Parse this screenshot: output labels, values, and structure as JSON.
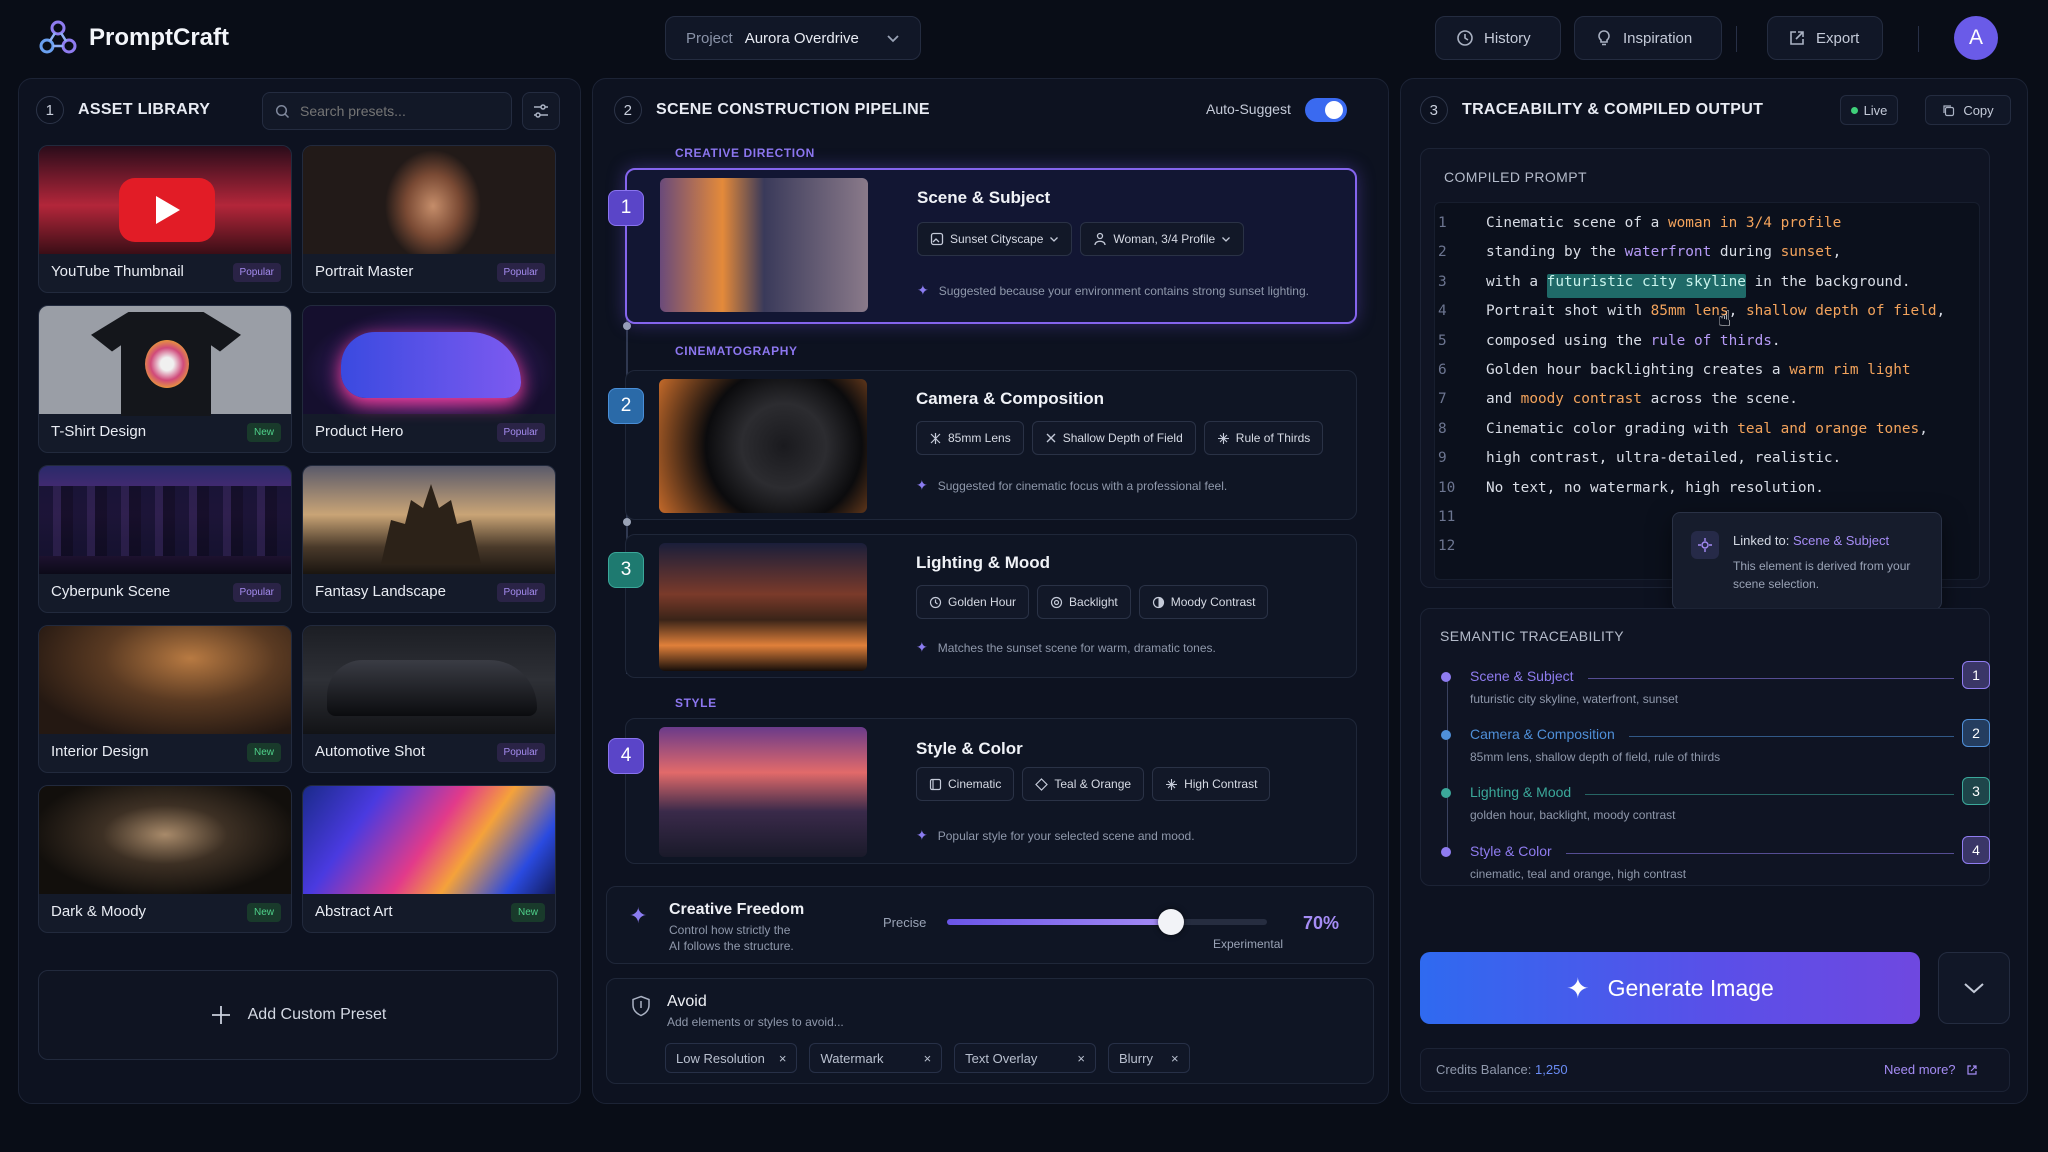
{
  "app": {
    "name": "PromptCraft"
  },
  "header": {
    "project_label": "Project",
    "project_name": "Aurora Overdrive",
    "history": "History",
    "inspiration": "Inspiration",
    "export": "Export",
    "avatar_initial": "A"
  },
  "library": {
    "num": "1",
    "title": "ASSET LIBRARY",
    "search_placeholder": "Search presets...",
    "add_custom": "Add Custom Preset",
    "presets": [
      {
        "label": "YouTube Thumbnail",
        "badge": "Popular"
      },
      {
        "label": "Portrait Master",
        "badge": "Popular"
      },
      {
        "label": "T-Shirt Design",
        "badge": "New"
      },
      {
        "label": "Product Hero",
        "badge": "Popular"
      },
      {
        "label": "Cyberpunk Scene",
        "badge": "Popular"
      },
      {
        "label": "Fantasy Landscape",
        "badge": "Popular"
      },
      {
        "label": "Interior Design",
        "badge": "New"
      },
      {
        "label": "Automotive Shot",
        "badge": "Popular"
      },
      {
        "label": "Dark & Moody",
        "badge": "New"
      },
      {
        "label": "Abstract Art",
        "badge": "New"
      }
    ]
  },
  "pipeline": {
    "num": "2",
    "title": "SCENE CONSTRUCTION PIPELINE",
    "auto_suggest": "Auto-Suggest",
    "auto_suggest_on": true,
    "sections": {
      "creative": "CREATIVE DIRECTION",
      "cinema": "CINEMATOGRAPHY",
      "style": "STYLE"
    },
    "steps": [
      {
        "num": "1",
        "title": "Scene & Subject",
        "chips": [
          "Sunset Cityscape",
          "Woman, 3/4 Profile"
        ],
        "hint": "Suggested because your environment contains strong sunset lighting."
      },
      {
        "num": "2",
        "title": "Camera & Composition",
        "chips": [
          "85mm Lens",
          "Shallow Depth of Field",
          "Rule of Thirds"
        ],
        "hint": "Suggested for cinematic focus with a professional feel."
      },
      {
        "num": "3",
        "title": "Lighting & Mood",
        "chips": [
          "Golden Hour",
          "Backlight",
          "Moody Contrast"
        ],
        "hint": "Matches the sunset scene for warm, dramatic tones."
      },
      {
        "num": "4",
        "title": "Style & Color",
        "chips": [
          "Cinematic",
          "Teal & Orange",
          "High Contrast"
        ],
        "hint": "Popular style for your selected scene and mood."
      }
    ],
    "freedom": {
      "title": "Creative Freedom",
      "desc1": "Control how strictly the",
      "desc2": "AI follows the structure.",
      "left": "Precise",
      "right": "Experimental",
      "value_label": "70%",
      "value": 0.7
    },
    "avoid": {
      "title": "Avoid",
      "desc": "Add elements or styles to avoid...",
      "tags": [
        "Low Resolution",
        "Watermark",
        "Text Overlay",
        "Blurry"
      ]
    }
  },
  "output": {
    "num": "3",
    "title": "TRACEABILITY & COMPILED OUTPUT",
    "live": "Live",
    "copy": "Copy",
    "compiled_title": "COMPILED PROMPT",
    "lines": [
      {
        "n": "1",
        "parts": [
          [
            "t",
            "Cinematic scene of a "
          ],
          [
            "o",
            "woman in 3/4 profile"
          ]
        ]
      },
      {
        "n": "2",
        "parts": [
          [
            "t",
            "standing by the "
          ],
          [
            "p",
            "waterfront"
          ],
          [
            "t",
            " during "
          ],
          [
            "o",
            "sunset"
          ],
          [
            "t",
            ","
          ]
        ]
      },
      {
        "n": "3",
        "parts": [
          [
            "t",
            "with a "
          ],
          [
            "hl",
            "futuristic city skyline"
          ],
          [
            "t",
            " in the background."
          ]
        ]
      },
      {
        "n": "4",
        "parts": [
          [
            "t",
            "Portrait shot with "
          ],
          [
            "o",
            "85mm lens"
          ],
          [
            "t",
            ", "
          ],
          [
            "o",
            "shallow depth of field"
          ],
          [
            "t",
            ","
          ]
        ]
      },
      {
        "n": "5",
        "parts": [
          [
            "t",
            "composed using the "
          ],
          [
            "p",
            "rule of thirds"
          ],
          [
            "t",
            "."
          ]
        ]
      },
      {
        "n": "6",
        "parts": [
          [
            "t",
            "Golden hour backlighting creates a "
          ],
          [
            "o",
            "warm rim light"
          ]
        ]
      },
      {
        "n": "7",
        "parts": [
          [
            "t",
            "and "
          ],
          [
            "o",
            "moody contrast"
          ],
          [
            "t",
            " across the scene."
          ]
        ]
      },
      {
        "n": "8",
        "parts": [
          [
            "t",
            "Cinematic color grading with "
          ],
          [
            "o",
            "teal and orange tones"
          ],
          [
            "t",
            ","
          ]
        ]
      },
      {
        "n": "9",
        "parts": [
          [
            "t",
            "high contrast, ultra-detailed, realistic."
          ]
        ]
      },
      {
        "n": "10",
        "parts": [
          [
            "t",
            "No text, no watermark, high resolution."
          ]
        ]
      },
      {
        "n": "11",
        "parts": []
      },
      {
        "n": "12",
        "parts": []
      }
    ],
    "tooltip": {
      "linked_prefix": "Linked to: ",
      "linked_target": "Scene & Subject",
      "desc1": "This element is derived from your",
      "desc2": "scene selection."
    },
    "semantic_title": "SEMANTIC TRACEABILITY",
    "trace": [
      {
        "name": "Scene & Subject",
        "desc": "futuristic city skyline, waterfront, sunset",
        "num": "1",
        "color": "#8f7cf0"
      },
      {
        "name": "Camera & Composition",
        "desc": "85mm lens, shallow depth of field, rule of thirds",
        "num": "2",
        "color": "#4f8fd8"
      },
      {
        "name": "Lighting & Mood",
        "desc": "golden hour, backlight, moody contrast",
        "num": "3",
        "color": "#3ba89a"
      },
      {
        "name": "Style & Color",
        "desc": "cinematic, teal and orange, high contrast",
        "num": "4",
        "color": "#8f7cf0"
      }
    ],
    "generate": "Generate Image",
    "credits_label": "Credits Balance:",
    "credits_value": "1,250",
    "need_more": "Need more?"
  }
}
